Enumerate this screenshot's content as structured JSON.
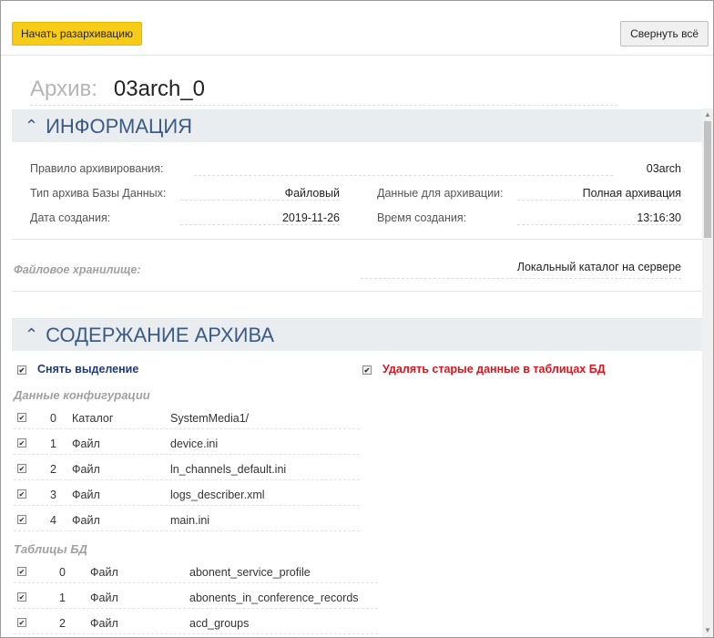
{
  "toolbar": {
    "start_label": "Начать разархивацию",
    "collapse_label": "Свернуть всё"
  },
  "archive": {
    "label": "Архив:",
    "name": "03arch_0"
  },
  "info_section": {
    "title": "ИНФОРМАЦИЯ",
    "rule_label": "Правило архивирования:",
    "rule_value": "03arch",
    "db_type_label": "Тип архива Базы Данных:",
    "db_type_value": "Файловый",
    "data_label": "Данные для архивации:",
    "data_value": "Полная архивация",
    "date_label": "Дата создания:",
    "date_value": "2019-11-26",
    "time_label": "Время создания:",
    "time_value": "13:16:30",
    "storage_label": "Файловое хранилище:",
    "storage_value": "Локальный каталог на сервере"
  },
  "content_section": {
    "title": "СОДЕРЖАНИЕ АРХИВА",
    "deselect_label": "Снять выделение",
    "delete_old_label": "Удалять старые данные в таблицах БД",
    "config_group_title": "Данные конфигурации",
    "config_items": [
      {
        "num": "0",
        "type": "Каталог",
        "name": "SystemMedia1/"
      },
      {
        "num": "1",
        "type": "Файл",
        "name": "device.ini"
      },
      {
        "num": "2",
        "type": "Файл",
        "name": "ln_channels_default.ini"
      },
      {
        "num": "3",
        "type": "Файл",
        "name": "logs_describer.xml"
      },
      {
        "num": "4",
        "type": "Файл",
        "name": "main.ini"
      }
    ],
    "db_group_title": "Таблицы БД",
    "db_items": [
      {
        "num": "0",
        "type": "Файл",
        "name": "abonent_service_profile"
      },
      {
        "num": "1",
        "type": "Файл",
        "name": "abonents_in_conference_records"
      },
      {
        "num": "2",
        "type": "Файл",
        "name": "acd_groups"
      }
    ]
  },
  "colors": {
    "accent_button": "#f7cc17",
    "section_header_bg": "#e9edf0",
    "section_header_text": "#3b5a86",
    "deselect_text": "#1f3a7a",
    "delete_text": "#e0121b"
  },
  "icons": {
    "section_chevron": "chevron-up-icon",
    "checkbox": "checkbox-checked-icon"
  }
}
